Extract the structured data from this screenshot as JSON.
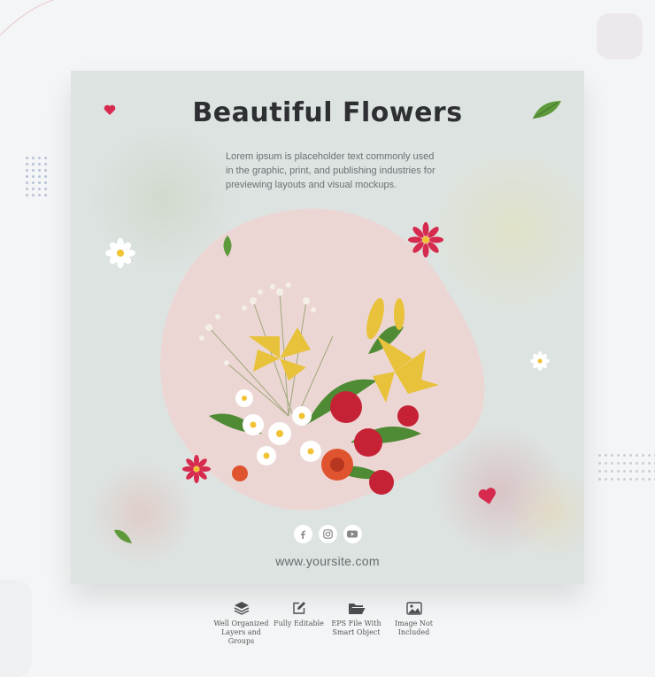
{
  "card": {
    "title": "Beautiful Flowers",
    "description": "Lorem ipsum is placeholder text commonly used in the graphic, print, and publishing industries for previewing layouts and visual mockups.",
    "website": "www.yoursite.com",
    "social_icons": [
      "facebook-icon",
      "instagram-icon",
      "youtube-icon"
    ]
  },
  "features": [
    {
      "icon": "layers-icon",
      "label": "Well Organized Layers and Groups"
    },
    {
      "icon": "edit-icon",
      "label": "Fully Editable"
    },
    {
      "icon": "folder-icon",
      "label": "EPS File With Smart Object"
    },
    {
      "icon": "image-icon",
      "label": "Image Not Included"
    }
  ],
  "colors": {
    "card_background": "#dde3e1",
    "blob_pink": "#ecd6d4",
    "accent_red": "#d62a4e",
    "leaf_green": "#5e9a3c",
    "title_text": "#2d2f32"
  }
}
